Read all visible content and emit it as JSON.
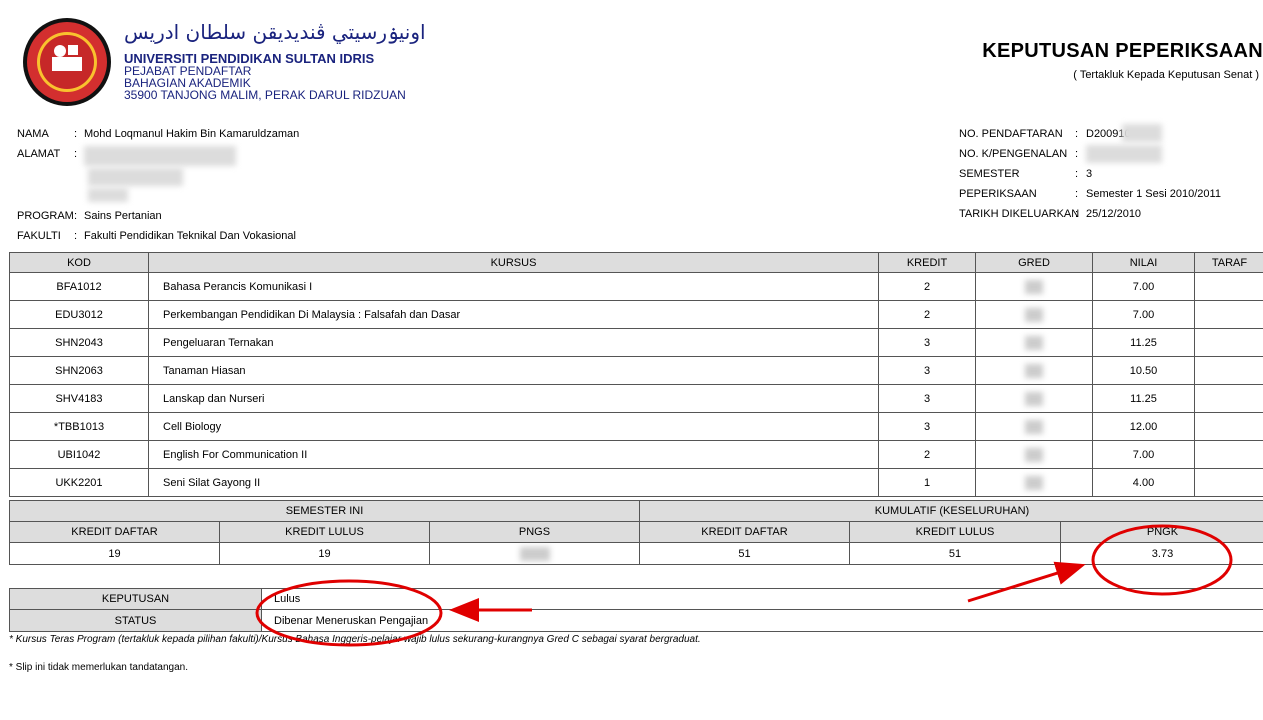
{
  "header": {
    "arabic_name": "اونيۏرسيتي ڤنديديقن سلطان ادريس",
    "university": "UNIVERSITI PENDIDIKAN SULTAN IDRIS",
    "office": "PEJABAT PENDAFTAR",
    "division": "BAHAGIAN AKADEMIK",
    "address": "35900 TANJONG MALIM, PERAK DARUL RIDZUAN",
    "doc_title": "KEPUTUSAN PEPERIKSAAN",
    "doc_subtitle": "( Tertakluk Kepada Keputusan Senat )"
  },
  "student": {
    "name_label": "NAMA",
    "name": "Mohd Loqmanul Hakim Bin Kamaruldzaman",
    "address_label": "ALAMAT",
    "program_label": "PROGRAM",
    "program": "Sains Pertanian",
    "faculty_label": "FAKULTI",
    "faculty": "Fakulti Pendidikan Teknikal Dan Vokasional",
    "regno_label": "NO. PENDAFTARAN",
    "regno": "D200910",
    "ic_label": "NO. K/PENGENALAN",
    "semester_label": "SEMESTER",
    "semester": "3",
    "exam_label": "PEPERIKSAAN",
    "exam": "Semester 1 Sesi 2010/2011",
    "issued_label": "TARIKH DIKELUARKAN",
    "issued": "25/12/2010"
  },
  "courses": {
    "headers": [
      "KOD",
      "KURSUS",
      "KREDIT",
      "GRED",
      "NILAI",
      "TARAF"
    ],
    "rows": [
      {
        "kod": "BFA1012",
        "kursus": "Bahasa Perancis Komunikasi I",
        "kredit": "2",
        "nilai": "7.00"
      },
      {
        "kod": "EDU3012",
        "kursus": "Perkembangan Pendidikan Di Malaysia : Falsafah dan Dasar",
        "kredit": "2",
        "nilai": "7.00"
      },
      {
        "kod": "SHN2043",
        "kursus": "Pengeluaran Ternakan",
        "kredit": "3",
        "nilai": "11.25"
      },
      {
        "kod": "SHN2063",
        "kursus": "Tanaman Hiasan",
        "kredit": "3",
        "nilai": "10.50"
      },
      {
        "kod": "SHV4183",
        "kursus": "Lanskap dan Nurseri",
        "kredit": "3",
        "nilai": "11.25"
      },
      {
        "kod": "*TBB1013",
        "kursus": "Cell Biology",
        "kredit": "3",
        "nilai": "12.00"
      },
      {
        "kod": "UBI1042",
        "kursus": "English For Communication II",
        "kredit": "2",
        "nilai": "7.00"
      },
      {
        "kod": "UKK2201",
        "kursus": "Seni Silat Gayong II",
        "kredit": "1",
        "nilai": "4.00"
      }
    ]
  },
  "summary": {
    "semester_label": "SEMESTER INI",
    "cumulative_label": "KUMULATIF (KESELURUHAN)",
    "headers": [
      "KREDIT DAFTAR",
      "KREDIT LULUS",
      "PNGS",
      "KREDIT DAFTAR",
      "KREDIT LULUS",
      "PNGK"
    ],
    "values": [
      "19",
      "19",
      "",
      "51",
      "51",
      "3.73"
    ]
  },
  "decision": {
    "keputusan_label": "KEPUTUSAN",
    "keputusan": "Lulus",
    "status_label": "STATUS",
    "status": "Dibenar Meneruskan Pengajian"
  },
  "notes": {
    "footnote": "* Kursus Teras Program (tertakluk kepada pilihan fakulti)/Kursus Bahasa Inggeris-pelajar wajib lulus sekurang-kurangnya Gred C sebagai syarat bergraduat.",
    "slip": "* Slip ini tidak memerlukan tandatangan."
  },
  "colors": {
    "annotation": "#e00000",
    "uni_blue": "#1a237e",
    "header_gray": "#dddddd"
  }
}
